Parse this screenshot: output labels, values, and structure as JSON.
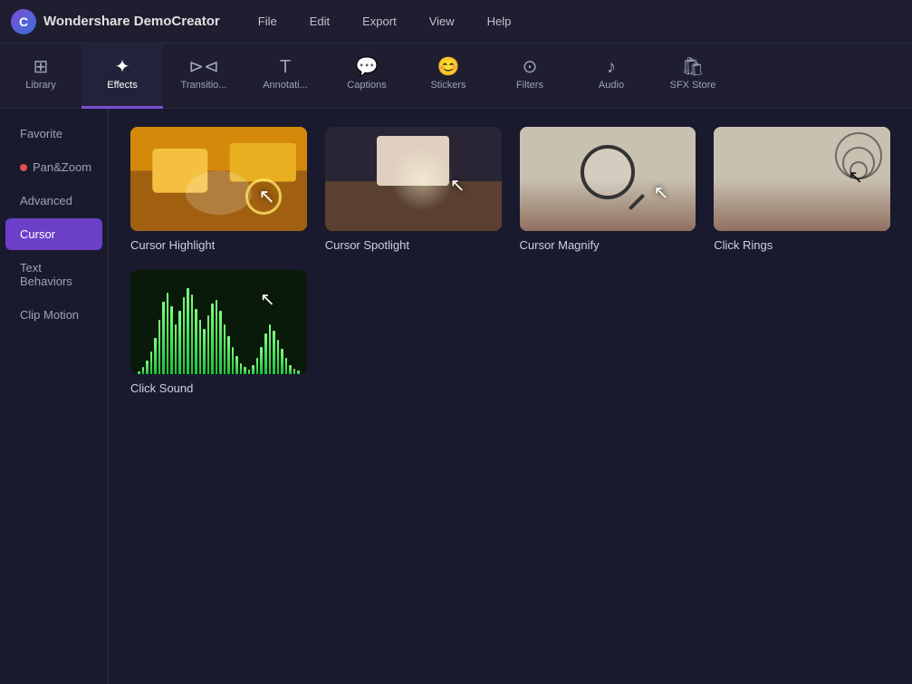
{
  "app": {
    "title": "Wondershare DemoCreator",
    "logo_letter": "C"
  },
  "menu": {
    "items": [
      "File",
      "Edit",
      "Export",
      "View",
      "Help"
    ]
  },
  "toolbar": {
    "items": [
      {
        "id": "library",
        "label": "Library",
        "icon": "⊞"
      },
      {
        "id": "effects",
        "label": "Effects",
        "icon": "✦",
        "active": true
      },
      {
        "id": "transitions",
        "label": "Transitio...",
        "icon": "⊳⊲"
      },
      {
        "id": "annotations",
        "label": "Annotati...",
        "icon": "T"
      },
      {
        "id": "captions",
        "label": "Captions",
        "icon": "💬"
      },
      {
        "id": "stickers",
        "label": "Stickers",
        "icon": "😊"
      },
      {
        "id": "filters",
        "label": "Filters",
        "icon": "⊙"
      },
      {
        "id": "audio",
        "label": "Audio",
        "icon": "♪"
      },
      {
        "id": "sfxstore",
        "label": "SFX Store",
        "icon": "🛍"
      }
    ]
  },
  "sidebar": {
    "items": [
      {
        "id": "favorite",
        "label": "Favorite",
        "active": false
      },
      {
        "id": "pan-zoom",
        "label": "Pan&Zoom",
        "active": false,
        "has_dot": true
      },
      {
        "id": "advanced",
        "label": "Advanced",
        "active": false
      },
      {
        "id": "cursor",
        "label": "Cursor",
        "active": true
      },
      {
        "id": "text-behaviors",
        "label": "Text Behaviors",
        "active": false
      },
      {
        "id": "clip-motion",
        "label": "Clip Motion",
        "active": false
      }
    ]
  },
  "effects": {
    "items": [
      {
        "id": "cursor-highlight",
        "label": "Cursor Highlight",
        "type": "highlight"
      },
      {
        "id": "cursor-spotlight",
        "label": "Cursor Spotlight",
        "type": "spotlight"
      },
      {
        "id": "cursor-magnify",
        "label": "Cursor Magnify",
        "type": "magnify"
      },
      {
        "id": "click-rings",
        "label": "Click Rings",
        "type": "clickrings"
      },
      {
        "id": "click-sound",
        "label": "Click Sound",
        "type": "clicksound"
      }
    ]
  },
  "wave_bars": [
    3,
    8,
    15,
    25,
    40,
    60,
    80,
    90,
    75,
    55,
    70,
    85,
    95,
    88,
    72,
    60,
    50,
    65,
    78,
    82,
    70,
    55,
    42,
    30,
    20,
    12,
    8,
    5,
    10,
    18,
    30,
    45,
    55,
    48,
    38,
    28,
    18,
    10,
    6,
    4
  ]
}
